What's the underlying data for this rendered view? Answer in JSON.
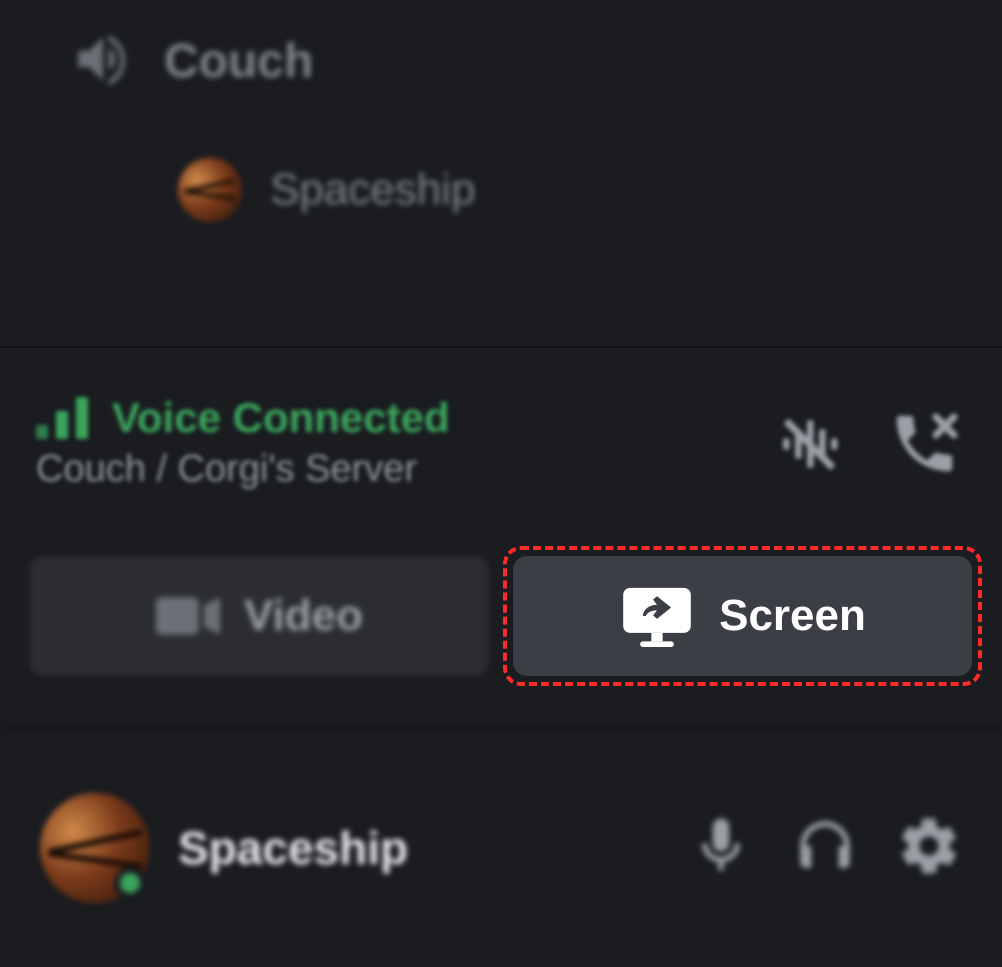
{
  "channel": {
    "name": "Couch",
    "type": "voice"
  },
  "member": {
    "name": "Spaceship"
  },
  "voice": {
    "status": "Voice Connected",
    "location": "Couch / Corgi's Server"
  },
  "buttons": {
    "video": "Video",
    "screen": "Screen"
  },
  "user": {
    "name": "Spaceship",
    "status": "online"
  },
  "highlight": {
    "target": "screen-share-button",
    "color": "#ff2a2a"
  }
}
